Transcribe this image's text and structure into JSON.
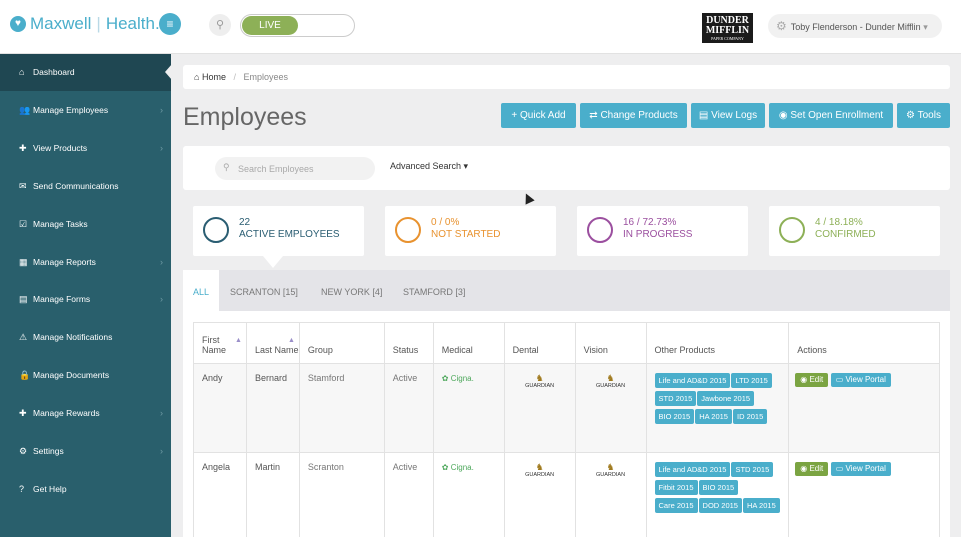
{
  "header": {
    "brand_primary": "Maxwell",
    "brand_secondary": "Health.",
    "live_label": "LIVE",
    "company_logo_line1": "DUNDER",
    "company_logo_line2": "MIFFLIN",
    "company_logo_tagline": "PAPER COMPANY",
    "user_label": "Toby Flenderson - Dunder Mifflin"
  },
  "sidebar": {
    "items": [
      {
        "label": "Dashboard",
        "icon": "dashboard-icon",
        "glyph": "⌂"
      },
      {
        "label": "Manage Employees",
        "icon": "users-icon",
        "glyph": "👥"
      },
      {
        "label": "View Products",
        "icon": "gift-icon",
        "glyph": "✚"
      },
      {
        "label": "Send Communications",
        "icon": "envelope-icon",
        "glyph": "✉"
      },
      {
        "label": "Manage Tasks",
        "icon": "checkbox-icon",
        "glyph": "☑"
      },
      {
        "label": "Manage Reports",
        "icon": "table-icon",
        "glyph": "▦"
      },
      {
        "label": "Manage Forms",
        "icon": "file-icon",
        "glyph": "▤"
      },
      {
        "label": "Manage Notifications",
        "icon": "warning-icon",
        "glyph": "⚠"
      },
      {
        "label": "Manage Documents",
        "icon": "lock-icon",
        "glyph": "🔒"
      },
      {
        "label": "Manage Rewards",
        "icon": "gift-icon",
        "glyph": "✚"
      },
      {
        "label": "Settings",
        "icon": "gears-icon",
        "glyph": "⚙"
      },
      {
        "label": "Get Help",
        "icon": "question-icon",
        "glyph": "?"
      }
    ]
  },
  "breadcrumb": {
    "home": "Home",
    "current": "Employees"
  },
  "page": {
    "title": "Employees"
  },
  "toolbar": {
    "quick_add": "+ Quick Add",
    "change_products": "⇄ Change Products",
    "view_logs": "▤ View Logs",
    "open_enrollment": "◉ Set Open Enrollment",
    "tools": "⚙ Tools"
  },
  "search": {
    "placeholder": "Search Employees",
    "advanced": "Advanced Search ▾"
  },
  "stats": [
    {
      "value": "22",
      "label": "ACTIVE EMPLOYEES",
      "color": "#2a5d72"
    },
    {
      "value": "0 / 0%",
      "label": "NOT STARTED",
      "color": "#e8922f"
    },
    {
      "value": "16 / 72.73%",
      "label": "IN PROGRESS",
      "color": "#9b4f9f"
    },
    {
      "value": "4 / 18.18%",
      "label": "CONFIRMED",
      "color": "#8db057"
    }
  ],
  "tabs": [
    "ALL",
    "SCRANTON [15]",
    "NEW YORK [4]",
    "STAMFORD [3]"
  ],
  "table": {
    "columns": [
      "First Name",
      "Last Name",
      "Group",
      "Status",
      "Medical",
      "Dental",
      "Vision",
      "Other Products",
      "Actions"
    ],
    "rows": [
      {
        "first": "Andy",
        "last": "Bernard",
        "group": "Stamford",
        "status": "Active",
        "medical": "Cigna.",
        "dental": "GUARDIAN",
        "vision": "GUARDIAN",
        "products": [
          "Life and AD&D 2015",
          "LTD 2015",
          "STD 2015",
          "Jawbone 2015",
          "BIO 2015",
          "HA 2015",
          "ID 2015"
        ],
        "edit": "Edit",
        "portal": "View Portal"
      },
      {
        "first": "Angela",
        "last": "Martin",
        "group": "Scranton",
        "status": "Active",
        "medical": "Cigna.",
        "dental": "GUARDIAN",
        "vision": "GUARDIAN",
        "products": [
          "Life and AD&D 2015",
          "STD 2015",
          "Fitbit 2015",
          "BIO 2015",
          "Care 2015",
          "DOD 2015",
          "HA 2015"
        ],
        "edit": "Edit",
        "portal": "View Portal"
      }
    ]
  },
  "colors": {
    "accent": "#4aaecb",
    "sidebar": "#295f6c",
    "live": "#8db057",
    "edit": "#7ba442"
  }
}
